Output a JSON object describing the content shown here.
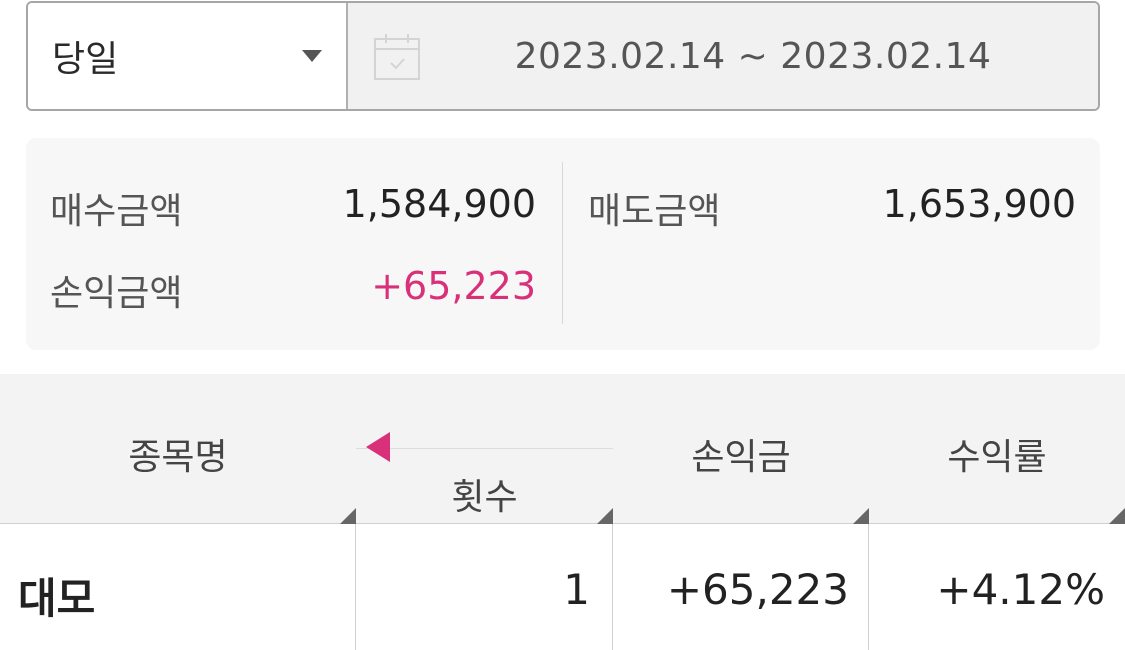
{
  "filter": {
    "period": "당일",
    "date_range": "2023.02.14 ~ 2023.02.14"
  },
  "summary": {
    "buy_label": "매수금액",
    "buy_value": "1,584,900",
    "sell_label": "매도금액",
    "sell_value": "1,653,900",
    "pnl_label": "손익금액",
    "pnl_value": "+65,223"
  },
  "table": {
    "headers": {
      "name": "종목명",
      "count": "횟수",
      "pnl": "손익금",
      "rate": "수익률"
    },
    "rows": [
      {
        "name": "대모",
        "count": "1",
        "pnl": "+65,223",
        "rate": "+4.12%"
      }
    ]
  },
  "colors": {
    "positive": "#d8317a",
    "border": "#a6a6a6"
  },
  "icons": {
    "calendar": "calendar-icon",
    "dropdown": "chevron-down-icon",
    "scroll_left": "arrow-left-icon"
  }
}
